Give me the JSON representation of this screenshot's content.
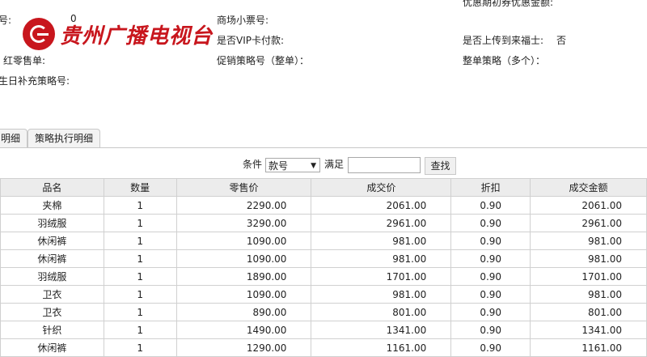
{
  "info": {
    "row0_right": "优惠期初券优惠金额:",
    "row1_left_label": "号:",
    "row1_left_value": "0",
    "row1_mid": "商场小票号:",
    "row2_mid": "是否VIP卡付款:",
    "row2_right_label": "是否上传到来福士:",
    "row2_right_value": "否",
    "row3_left": "红零售单:",
    "row3_mid": "促销策略号（整单）：",
    "row3_right": "整单策略（多个）：",
    "row4_left": "生日补充策略号:"
  },
  "logo": {
    "text": "贵州广播电视台"
  },
  "tabs": [
    {
      "label": "明细"
    },
    {
      "label": "策略执行明细"
    }
  ],
  "filter": {
    "condition_label": "条件",
    "select_value": "款号",
    "satisfy_label": "满足",
    "input_value": "",
    "search_label": "查找"
  },
  "table": {
    "headers": [
      "品名",
      "数量",
      "零售价",
      "成交价",
      "折扣",
      "成交金额"
    ],
    "rows": [
      [
        "夹棉",
        "1",
        "2290.00",
        "2061.00",
        "0.90",
        "2061.00"
      ],
      [
        "羽绒服",
        "1",
        "3290.00",
        "2961.00",
        "0.90",
        "2961.00"
      ],
      [
        "休闲裤",
        "1",
        "1090.00",
        "981.00",
        "0.90",
        "981.00"
      ],
      [
        "休闲裤",
        "1",
        "1090.00",
        "981.00",
        "0.90",
        "981.00"
      ],
      [
        "羽绒服",
        "1",
        "1890.00",
        "1701.00",
        "0.90",
        "1701.00"
      ],
      [
        "卫衣",
        "1",
        "1090.00",
        "981.00",
        "0.90",
        "981.00"
      ],
      [
        "卫衣",
        "1",
        "890.00",
        "801.00",
        "0.90",
        "801.00"
      ],
      [
        "针织",
        "1",
        "1490.00",
        "1341.00",
        "0.90",
        "1341.00"
      ],
      [
        "休闲裤",
        "1",
        "1290.00",
        "1161.00",
        "0.90",
        "1161.00"
      ]
    ]
  }
}
